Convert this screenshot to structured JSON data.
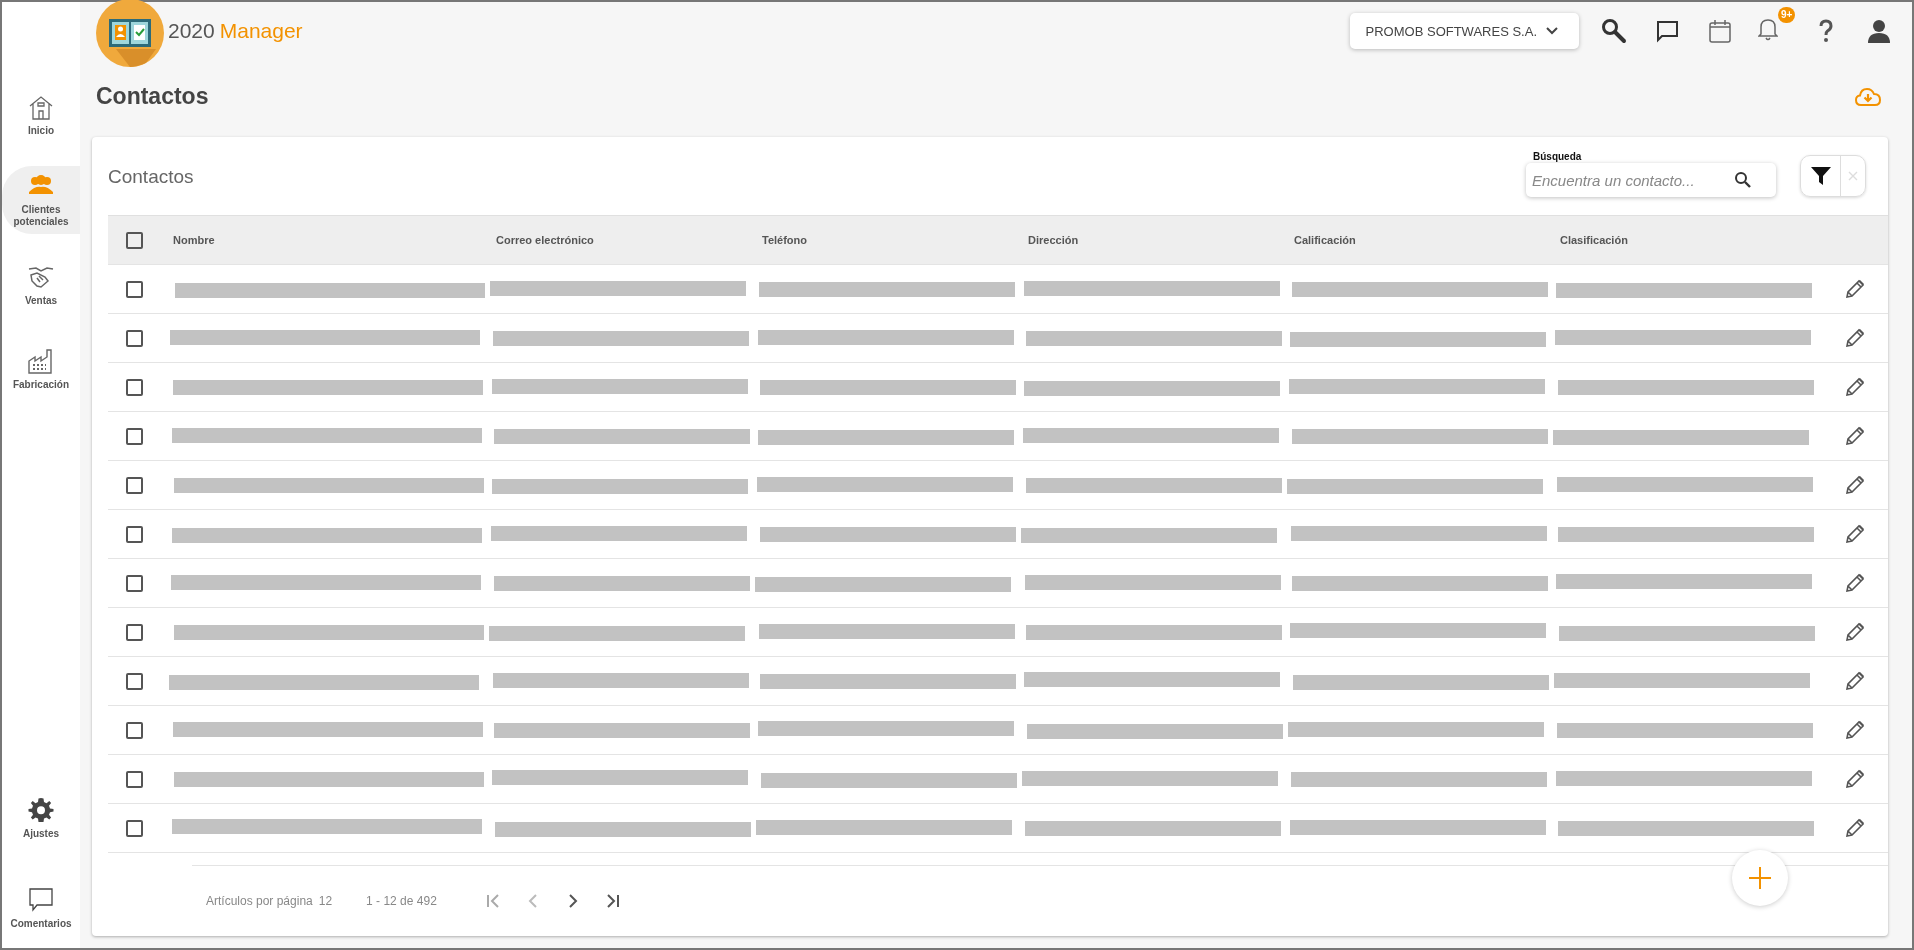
{
  "app": {
    "logo_number": "2020",
    "logo_word": "Manager"
  },
  "header": {
    "company": "PROMOB SOFTWARES S.A.",
    "notification_badge": "9+"
  },
  "sidebar": {
    "items": [
      {
        "label": "Inicio",
        "selected": false
      },
      {
        "label": "Clientes potenciales",
        "selected": true
      },
      {
        "label": "Ventas",
        "selected": false
      },
      {
        "label": "Fabricación",
        "selected": false
      }
    ],
    "bottom_items": [
      {
        "label": "Ajustes",
        "selected": false
      },
      {
        "label": "Comentarios",
        "selected": false
      }
    ]
  },
  "page": {
    "title": "Contactos"
  },
  "card": {
    "title": "Contactos",
    "search": {
      "label": "Búsqueda",
      "placeholder": "Encuentra un contacto..."
    },
    "table": {
      "select_all_checked": false,
      "columns": [
        "Nombre",
        "Correo electrónico",
        "Teléfono",
        "Dirección",
        "Calificación",
        "Clasificación"
      ],
      "rows": [
        {
          "checked": false,
          "redacted": true
        },
        {
          "checked": false,
          "redacted": true
        },
        {
          "checked": false,
          "redacted": true
        },
        {
          "checked": false,
          "redacted": true
        },
        {
          "checked": false,
          "redacted": true
        },
        {
          "checked": false,
          "redacted": true
        },
        {
          "checked": false,
          "redacted": true
        },
        {
          "checked": false,
          "redacted": true
        },
        {
          "checked": false,
          "redacted": true
        },
        {
          "checked": false,
          "redacted": true
        },
        {
          "checked": false,
          "redacted": true
        },
        {
          "checked": false,
          "redacted": true
        }
      ]
    },
    "pagination": {
      "per_page_label": "Artículos por página",
      "per_page": "12",
      "range": "1 - 12 de 492"
    }
  }
}
